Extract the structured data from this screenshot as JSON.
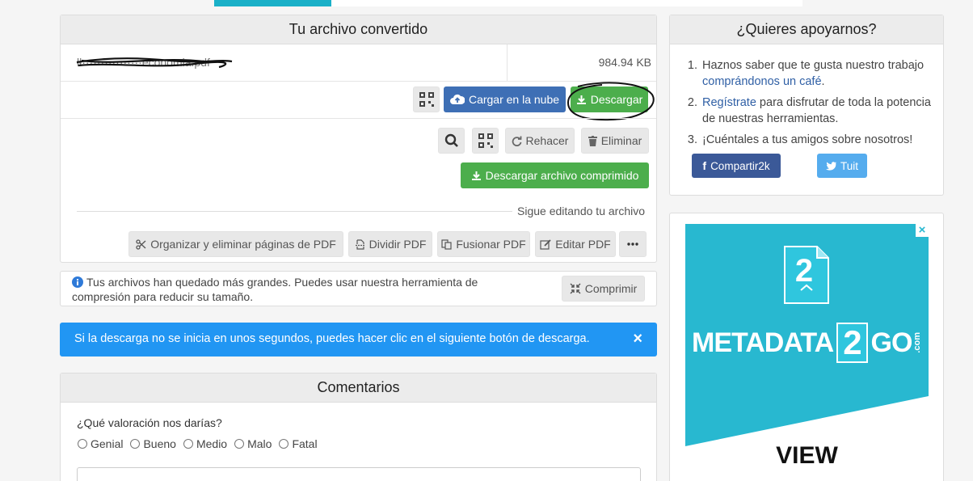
{
  "converted": {
    "title": "Tu archivo convertido",
    "file_name": "łł················economia.pdf",
    "file_size": "984.94 KB",
    "cloud_label": "Cargar en la nube",
    "download_label": "Descargar",
    "redo_label": "Rehacer",
    "delete_label": "Eliminar",
    "download_zip_label": "Descargar archivo comprimido",
    "keep_editing": "Sigue editando tu archivo",
    "tools": {
      "organize": "Organizar y eliminar páginas de PDF",
      "split": "Dividir PDF",
      "merge": "Fusionar PDF",
      "edit": "Editar PDF"
    }
  },
  "notice": {
    "text": "Tus archivos han quedado más grandes. Puedes usar nuestra herramienta de compresión para reducir su tamaño.",
    "compress_label": "Comprimir"
  },
  "alert": {
    "text": "Si la descarga no se inicia en unos segundos, puedes hacer clic en el siguiente botón de descarga.",
    "close": "×"
  },
  "comments": {
    "title": "Comentarios",
    "question": "¿Qué valoración nos darías?",
    "options": [
      "Genial",
      "Bueno",
      "Medio",
      "Malo",
      "Fatal"
    ]
  },
  "support": {
    "title": "¿Quieres apoyarnos?",
    "item1_pre": "Haznos saber que te gusta nuestro trabajo ",
    "item1_link": "comprándonos un café",
    "item1_post": ".",
    "item2_link": "Regístrate",
    "item2_post": " para disfrutar de toda la potencia de nuestras herramientas.",
    "item3": "¡Cuéntales a tus amigos sobre nosotros!",
    "share_facebook": "Compartir2k",
    "share_twitter": "Tuit"
  },
  "ad": {
    "badge": "2",
    "brand_left": "METADATA",
    "brand_mid": "2",
    "brand_right": "GO",
    "brand_suffix": ".com",
    "cta": "VIEW",
    "close": "×"
  },
  "colors": {
    "accent": "#1ab0c8",
    "alert_bg": "#2196f3",
    "green": "#4cae4c",
    "blue": "#3e6fb5",
    "facebook": "#3b5998",
    "twitter": "#55acee",
    "ad_teal": "#28b8d0"
  }
}
